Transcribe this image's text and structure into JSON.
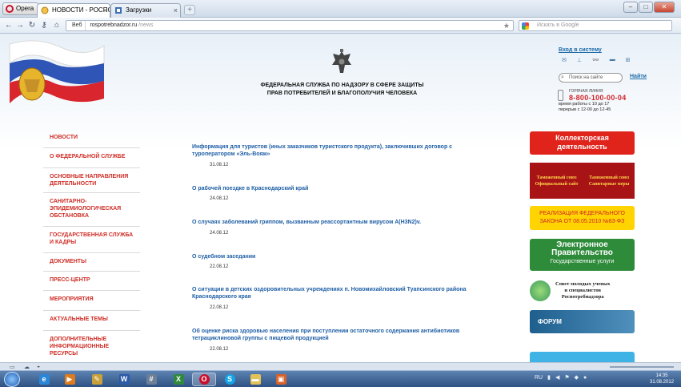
{
  "browser": {
    "menu_label": "Opera",
    "tabs": [
      {
        "label": "НОВОСТИ - РОСПОТ..."
      },
      {
        "label": "Загрузки"
      }
    ],
    "url_badge": "Веб",
    "url_domain": "rospotrebnadzor.ru",
    "url_path": "/news",
    "search_placeholder": "Искать в Google"
  },
  "header": {
    "title_line1": "ФЕДЕРАЛЬНАЯ СЛУЖБА ПО НАДЗОРУ В СФЕРЕ ЗАЩИТЫ",
    "title_line2": "ПРАВ ПОТРЕБИТЕЛЕЙ И БЛАГОПОЛУЧИЯ ЧЕЛОВЕКА",
    "login_link": "Вход в систему",
    "search_placeholder": "Поиск на сайте",
    "search_button": "Найти",
    "hotline_label": "ГОРЯЧАЯ ЛИНИЯ",
    "hotline_phone": "8-800-100-00-04",
    "hotline_hours1": "время работы с 10 до 17",
    "hotline_hours2": "перерыв с 12-00 до 12-45"
  },
  "nav": [
    "НОВОСТИ",
    "О ФЕДЕРАЛЬНОЙ СЛУЖБЕ",
    "ОСНОВНЫЕ НАПРАВЛЕНИЯ ДЕЯТЕЛЬНОСТИ",
    "САНИТАРНО-ЭПИДЕМИОЛОГИЧЕСКАЯ ОБСТАНОВКА",
    "ГОСУДАРСТВЕННАЯ СЛУЖБА И КАДРЫ",
    "ДОКУМЕНТЫ",
    "ПРЕСС-ЦЕНТР",
    "МЕРОПРИЯТИЯ",
    "АКТУАЛЬНЫЕ ТЕМЫ",
    "ДОПОЛНИТЕЛЬНЫЕ ИНФОРМАЦИОННЫЕ РЕСУРСЫ"
  ],
  "news": [
    {
      "title": "Информация для туристов (иных заказчиков туристского продукта), заключивших договор с туроператором «Эль-Вояж»",
      "date": "31.08.12"
    },
    {
      "title": "О рабочей поездке в Краснодарский край",
      "date": "24.08.12"
    },
    {
      "title": "О случаях заболеваний гриппом, вызванным реассортантным вирусом A(H3N2)v.",
      "date": "24.08.12"
    },
    {
      "title": "О судебном заседании",
      "date": "22.08.12"
    },
    {
      "title": "О ситуации в детских оздоровительных учреждениях п. Новомихайловский Туапсинского района Краснодарского края",
      "date": "22.08.12"
    },
    {
      "title": "Об оценке риска здоровью населения при поступлении остаточного содержания антибиотиков тетрациклиновой группы с пищевой продукцией",
      "date": "22.08.12"
    }
  ],
  "banners": {
    "collector_l1": "Коллекторская",
    "collector_l2": "деятельность",
    "customs_left_l1": "Таможенный союз",
    "customs_left_l2": "Официальный сайт",
    "customs_right_l1": "Таможенный союз",
    "customs_right_l2": "Санитарные меры",
    "law_l1": "РЕАЛИЗАЦИЯ ФЕДЕРАЛЬНОГО",
    "law_l2": "ЗАКОНА ОТ 08.05.2010 №83-ФЗ",
    "egov_l1": "Электронное",
    "egov_l2": "Правительство",
    "egov_l3": "Государственные услуги",
    "council_l1": "Совет молодых ученых",
    "council_l2": "и специалистов",
    "council_l3": "Роспотребнадзора",
    "forum": "ФОРУМ"
  },
  "taskbar": {
    "lang": "RU",
    "time": "14:35",
    "date": "31.08.2012"
  },
  "colors": {
    "nav_red": "#cf2d26",
    "news_blue": "#1f5fa5",
    "hotline_red": "#d0232a"
  }
}
